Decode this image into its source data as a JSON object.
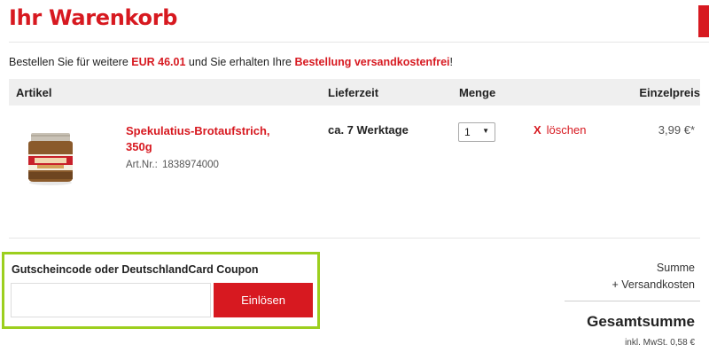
{
  "header": {
    "title": "Ihr Warenkorb"
  },
  "notice": {
    "prefix": "Bestellen Sie für weitere",
    "amount": "EUR 46.01",
    "middle": "und Sie erhalten Ihre",
    "highlight": "Bestellung versandkostenfrei",
    "suffix": "!"
  },
  "table": {
    "columns": {
      "article": "Artikel",
      "delivery": "Lieferzeit",
      "quantity": "Menge",
      "unit_price": "Einzelpreis"
    }
  },
  "item": {
    "name": "Spekulatius-Brotaufstrich, 350g",
    "artnr_label": "Art.Nr.:",
    "artnr": "1838974000",
    "delivery": "ca. 7 Werktage",
    "quantity": "1",
    "remove_x": "X",
    "remove_label": "löschen",
    "unit_price": "3,99 €*",
    "image_icon": "product-jar-image"
  },
  "coupon": {
    "label": "Gutscheincode oder DeutschlandCard Coupon",
    "value": "",
    "placeholder": "",
    "button_label": "Einlösen"
  },
  "summary": {
    "sum_label": "Summe",
    "shipping_label": "+ Versandkosten",
    "total_label": "Gesamtsumme",
    "vat_note": "inkl. MwSt. 0,58 €"
  },
  "colors": {
    "brand_red": "#d71920",
    "coupon_border": "#9ccf1e",
    "header_bg": "#efefef"
  }
}
